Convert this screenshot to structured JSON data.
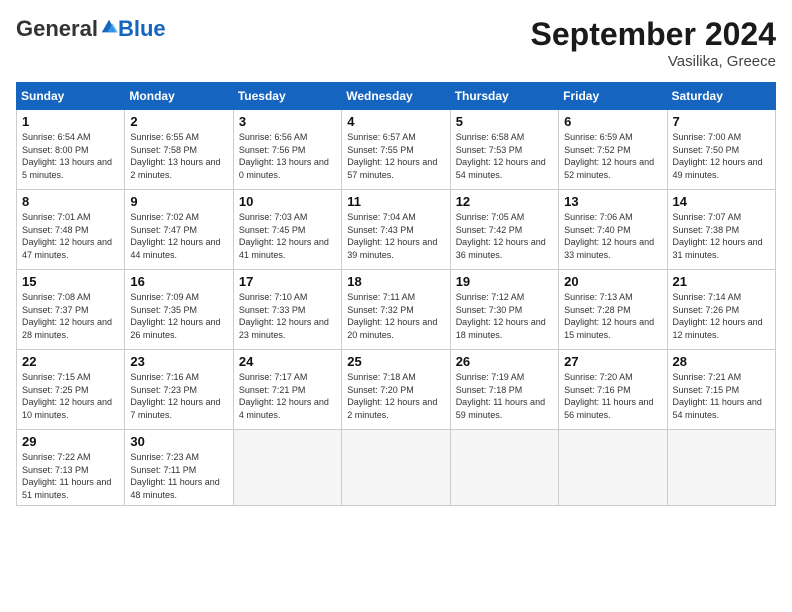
{
  "header": {
    "logo_general": "General",
    "logo_blue": "Blue",
    "month_title": "September 2024",
    "subtitle": "Vasilika, Greece"
  },
  "days_of_week": [
    "Sunday",
    "Monday",
    "Tuesday",
    "Wednesday",
    "Thursday",
    "Friday",
    "Saturday"
  ],
  "weeks": [
    [
      {
        "day": "1",
        "sunrise": "6:54 AM",
        "sunset": "8:00 PM",
        "daylight": "13 hours and 5 minutes."
      },
      {
        "day": "2",
        "sunrise": "6:55 AM",
        "sunset": "7:58 PM",
        "daylight": "13 hours and 2 minutes."
      },
      {
        "day": "3",
        "sunrise": "6:56 AM",
        "sunset": "7:56 PM",
        "daylight": "13 hours and 0 minutes."
      },
      {
        "day": "4",
        "sunrise": "6:57 AM",
        "sunset": "7:55 PM",
        "daylight": "12 hours and 57 minutes."
      },
      {
        "day": "5",
        "sunrise": "6:58 AM",
        "sunset": "7:53 PM",
        "daylight": "12 hours and 54 minutes."
      },
      {
        "day": "6",
        "sunrise": "6:59 AM",
        "sunset": "7:52 PM",
        "daylight": "12 hours and 52 minutes."
      },
      {
        "day": "7",
        "sunrise": "7:00 AM",
        "sunset": "7:50 PM",
        "daylight": "12 hours and 49 minutes."
      }
    ],
    [
      {
        "day": "8",
        "sunrise": "7:01 AM",
        "sunset": "7:48 PM",
        "daylight": "12 hours and 47 minutes."
      },
      {
        "day": "9",
        "sunrise": "7:02 AM",
        "sunset": "7:47 PM",
        "daylight": "12 hours and 44 minutes."
      },
      {
        "day": "10",
        "sunrise": "7:03 AM",
        "sunset": "7:45 PM",
        "daylight": "12 hours and 41 minutes."
      },
      {
        "day": "11",
        "sunrise": "7:04 AM",
        "sunset": "7:43 PM",
        "daylight": "12 hours and 39 minutes."
      },
      {
        "day": "12",
        "sunrise": "7:05 AM",
        "sunset": "7:42 PM",
        "daylight": "12 hours and 36 minutes."
      },
      {
        "day": "13",
        "sunrise": "7:06 AM",
        "sunset": "7:40 PM",
        "daylight": "12 hours and 33 minutes."
      },
      {
        "day": "14",
        "sunrise": "7:07 AM",
        "sunset": "7:38 PM",
        "daylight": "12 hours and 31 minutes."
      }
    ],
    [
      {
        "day": "15",
        "sunrise": "7:08 AM",
        "sunset": "7:37 PM",
        "daylight": "12 hours and 28 minutes."
      },
      {
        "day": "16",
        "sunrise": "7:09 AM",
        "sunset": "7:35 PM",
        "daylight": "12 hours and 26 minutes."
      },
      {
        "day": "17",
        "sunrise": "7:10 AM",
        "sunset": "7:33 PM",
        "daylight": "12 hours and 23 minutes."
      },
      {
        "day": "18",
        "sunrise": "7:11 AM",
        "sunset": "7:32 PM",
        "daylight": "12 hours and 20 minutes."
      },
      {
        "day": "19",
        "sunrise": "7:12 AM",
        "sunset": "7:30 PM",
        "daylight": "12 hours and 18 minutes."
      },
      {
        "day": "20",
        "sunrise": "7:13 AM",
        "sunset": "7:28 PM",
        "daylight": "12 hours and 15 minutes."
      },
      {
        "day": "21",
        "sunrise": "7:14 AM",
        "sunset": "7:26 PM",
        "daylight": "12 hours and 12 minutes."
      }
    ],
    [
      {
        "day": "22",
        "sunrise": "7:15 AM",
        "sunset": "7:25 PM",
        "daylight": "12 hours and 10 minutes."
      },
      {
        "day": "23",
        "sunrise": "7:16 AM",
        "sunset": "7:23 PM",
        "daylight": "12 hours and 7 minutes."
      },
      {
        "day": "24",
        "sunrise": "7:17 AM",
        "sunset": "7:21 PM",
        "daylight": "12 hours and 4 minutes."
      },
      {
        "day": "25",
        "sunrise": "7:18 AM",
        "sunset": "7:20 PM",
        "daylight": "12 hours and 2 minutes."
      },
      {
        "day": "26",
        "sunrise": "7:19 AM",
        "sunset": "7:18 PM",
        "daylight": "11 hours and 59 minutes."
      },
      {
        "day": "27",
        "sunrise": "7:20 AM",
        "sunset": "7:16 PM",
        "daylight": "11 hours and 56 minutes."
      },
      {
        "day": "28",
        "sunrise": "7:21 AM",
        "sunset": "7:15 PM",
        "daylight": "11 hours and 54 minutes."
      }
    ],
    [
      {
        "day": "29",
        "sunrise": "7:22 AM",
        "sunset": "7:13 PM",
        "daylight": "11 hours and 51 minutes."
      },
      {
        "day": "30",
        "sunrise": "7:23 AM",
        "sunset": "7:11 PM",
        "daylight": "11 hours and 48 minutes."
      },
      null,
      null,
      null,
      null,
      null
    ]
  ]
}
